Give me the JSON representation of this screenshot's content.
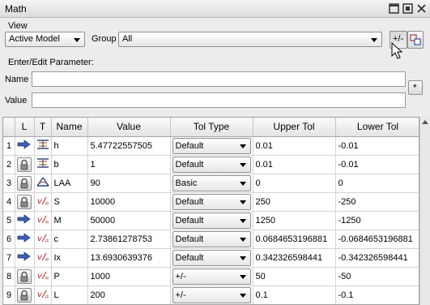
{
  "window": {
    "title": "Math"
  },
  "view": {
    "label": "View",
    "model_select": "Active Model",
    "group_label": "Group",
    "group_select": "All"
  },
  "toolbar": {
    "tolerance_button": "+/-"
  },
  "edit": {
    "section_label": "Enter/Edit Parameter:",
    "name_label": "Name",
    "name_value": "",
    "value_label": "Value",
    "value_value": "",
    "insert_button": "*"
  },
  "table": {
    "headers": [
      "",
      "L",
      "T",
      "Name",
      "Value",
      "Tol Type",
      "Upper Tol",
      "Lower Tol"
    ],
    "rows": [
      {
        "num": "1",
        "locked": false,
        "type_icon": "dimension-icon",
        "name": "h",
        "value": "5.47722557505",
        "tol_type": "Default",
        "upper": "0.01",
        "lower": "-0.01"
      },
      {
        "num": "2",
        "locked": true,
        "type_icon": "dimension-icon",
        "name": "b",
        "value": "1",
        "tol_type": "Default",
        "upper": "0.01",
        "lower": "-0.01"
      },
      {
        "num": "3",
        "locked": true,
        "type_icon": "angle-icon",
        "name": "LAA",
        "value": "90",
        "tol_type": "Basic",
        "upper": "0",
        "lower": "0"
      },
      {
        "num": "4",
        "locked": true,
        "type_icon": "variable-icon",
        "name": "S",
        "value": "10000",
        "tol_type": "Default",
        "upper": "250",
        "lower": "-250"
      },
      {
        "num": "5",
        "locked": false,
        "type_icon": "variable-icon",
        "name": "M",
        "value": "50000",
        "tol_type": "Default",
        "upper": "1250",
        "lower": "-1250"
      },
      {
        "num": "6",
        "locked": false,
        "type_icon": "variable-icon",
        "name": "c",
        "value": "2.73861278753",
        "tol_type": "Default",
        "upper": "0.0684653196881",
        "lower": "-0.0684653196881"
      },
      {
        "num": "7",
        "locked": false,
        "type_icon": "variable-icon",
        "name": "Ix",
        "value": "13.6930639376",
        "tol_type": "Default",
        "upper": "0.342326598441",
        "lower": "-0.342326598441"
      },
      {
        "num": "8",
        "locked": true,
        "type_icon": "variable-icon",
        "name": "P",
        "value": "1000",
        "tol_type": "+/-",
        "upper": "50",
        "lower": "-50"
      },
      {
        "num": "9",
        "locked": true,
        "type_icon": "variable-icon",
        "name": "L",
        "value": "200",
        "tol_type": "+/-",
        "upper": "0.1",
        "lower": "-0.1"
      }
    ]
  }
}
